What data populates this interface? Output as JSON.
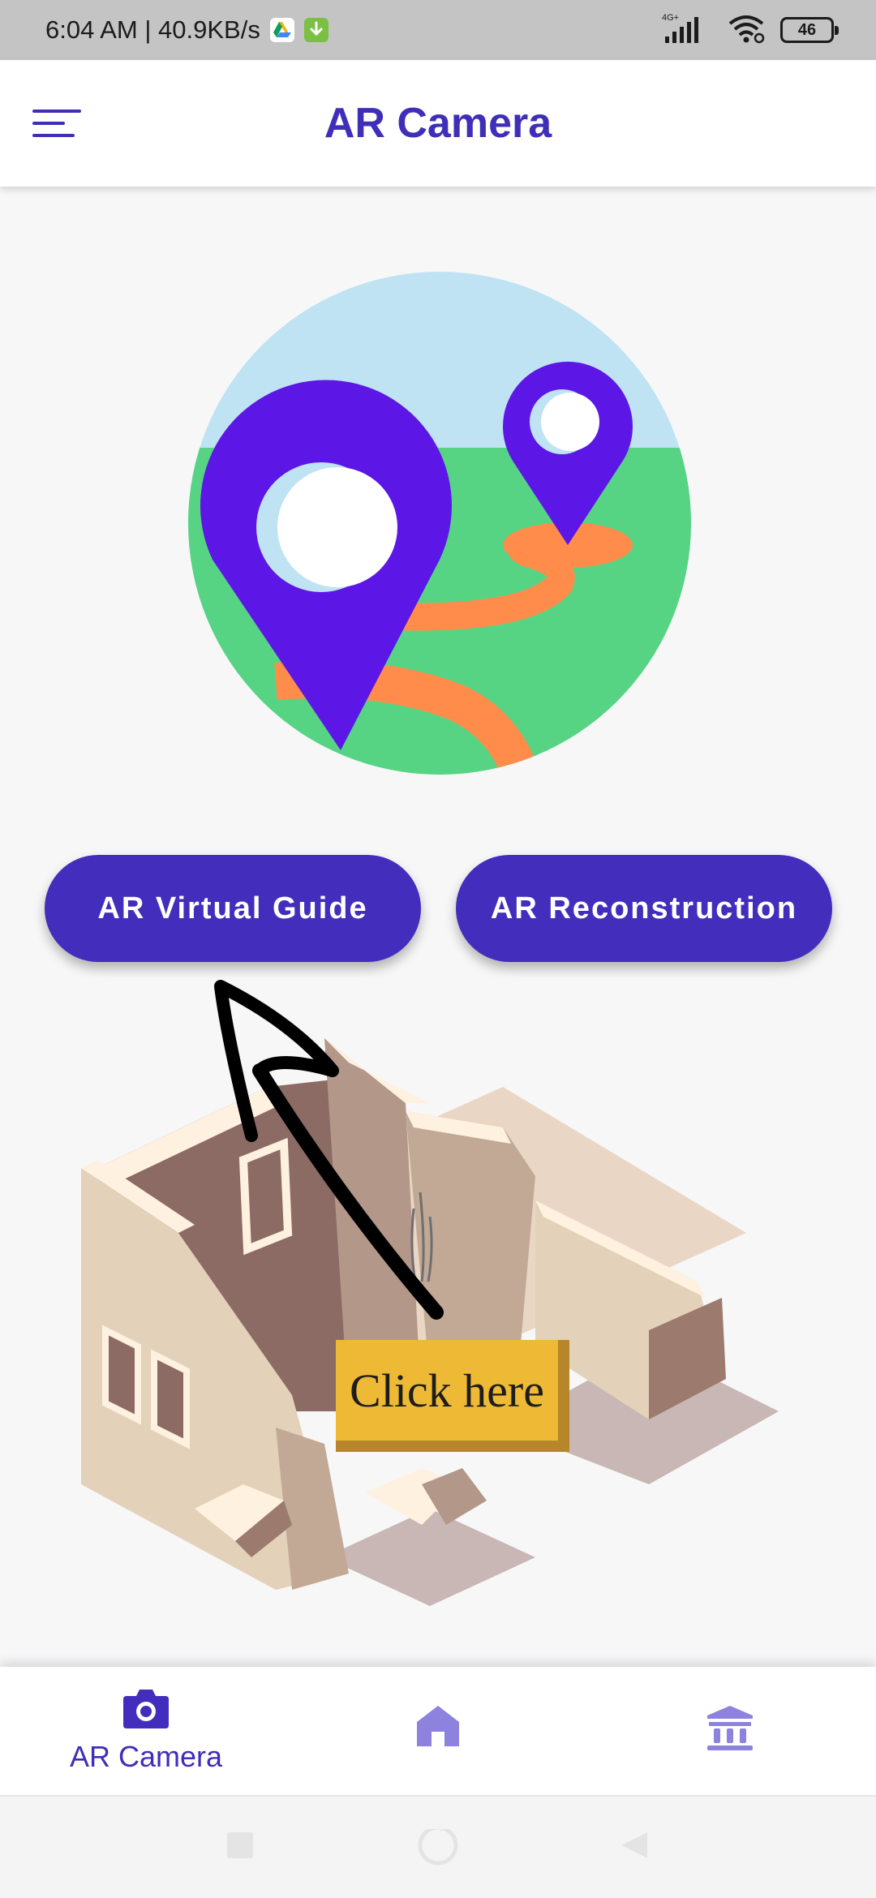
{
  "status_bar": {
    "time_speed": "6:04 AM | 40.9KB/s",
    "network_label": "4G+",
    "battery_level": "46"
  },
  "app_bar": {
    "title": "AR Camera"
  },
  "buttons": {
    "virtual_guide": "AR Virtual Guide",
    "reconstruction": "AR Reconstruction"
  },
  "tooltip": {
    "text": "Click here"
  },
  "bottom_nav": {
    "items": [
      {
        "label": "AR Camera",
        "icon": "camera-icon",
        "active": true
      },
      {
        "label": "",
        "icon": "home-icon",
        "active": false
      },
      {
        "label": "",
        "icon": "museum-icon",
        "active": false
      }
    ]
  },
  "colors": {
    "primary": "#432dbc",
    "title": "#3f2fb8",
    "pin": "#5c17e6",
    "ground": "#56d484",
    "sky": "#bfe3f3",
    "path": "#ff8c4b",
    "tooltip": "#eeb935"
  }
}
